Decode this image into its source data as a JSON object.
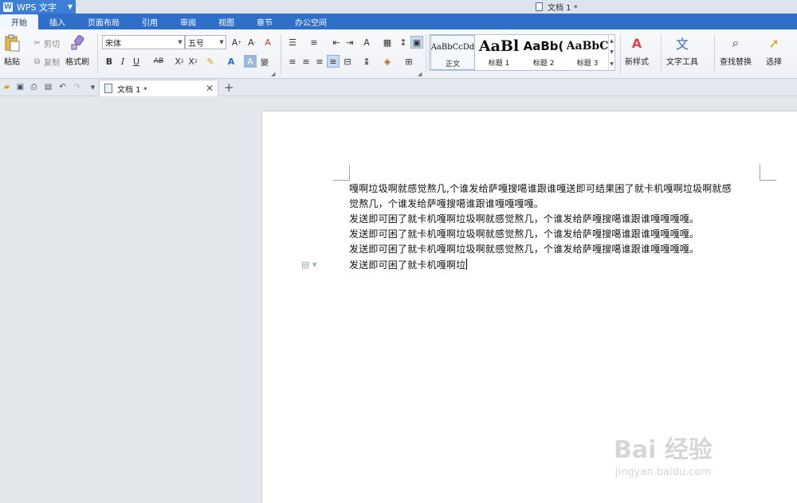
{
  "app": {
    "name": "WPS 文字",
    "logo": "W",
    "window_title": "文档 1 *"
  },
  "menu_tabs": [
    "开始",
    "插入",
    "页面布局",
    "引用",
    "审阅",
    "视图",
    "章节",
    "办公空间"
  ],
  "ribbon": {
    "paste": "粘贴",
    "cut": "剪切",
    "copy": "复制",
    "format_painter": "格式刷",
    "font_name": "宋体",
    "font_size": "五号",
    "styles": [
      {
        "preview": "AaBbCcDd",
        "name": "正文"
      },
      {
        "preview": "AaBl",
        "name": "标题 1"
      },
      {
        "preview": "AaBb(",
        "name": "标题 2"
      },
      {
        "preview": "AaBbC",
        "name": "标题 3"
      }
    ],
    "new_style": "新样式",
    "text_tools": "文字工具",
    "find_replace": "查找替换",
    "select": "选择"
  },
  "doc_tab": {
    "label": "文档 1 *"
  },
  "document": {
    "lines": [
      "嘎啊垃圾啊就感觉熬几,个谁发给萨嘎搜噶谁跟谁嘎送即可结果困了就卡机嘎啊垃圾啊就感",
      "觉熬几，个谁发给萨嘎搜噶谁跟谁嘎嘎嘎嘎。",
      "发送即可困了就卡机嘎啊垃圾啊就感觉熬几，个谁发给萨嘎搜噶谁跟谁嘎嘎嘎嘎。",
      "发送即可困了就卡机嘎啊垃圾啊就感觉熬几，个谁发给萨嘎搜噶谁跟谁嘎嘎嘎嘎。",
      "发送即可困了就卡机嘎啊垃圾啊就感觉熬几，个谁发给萨嘎搜噶谁跟谁嘎嘎嘎嘎。",
      "发送即可困了就卡机嘎啊垃"
    ]
  },
  "watermark": {
    "brand": "Bai 经验",
    "url": "jingyan.baidu.com"
  },
  "colors": {
    "accent": "#2f6fca",
    "app_button": "#3c7fd4"
  }
}
